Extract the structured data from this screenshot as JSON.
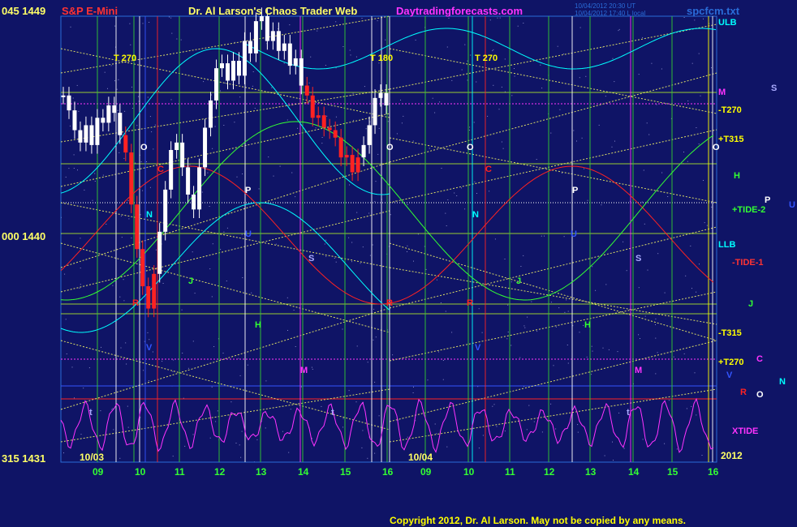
{
  "header": {
    "top_left_price": "045 1449",
    "instrument": "S&P E-Mini",
    "title": "Dr. Al Larson's Chaos Trader Web",
    "website": "Daytradingforecasts.com",
    "timestamp_1": "10/04/2012 20:30 UT",
    "timestamp_2": "10/04/2012 17:40 L local",
    "file": "spcfcm.txt"
  },
  "left_axis": {
    "mid_label": "000 1440",
    "bottom_label": "315 1431"
  },
  "footer": {
    "copyright": "Copyright 2012, Dr. Al Larson. May not be copied by any means."
  },
  "chart_data": {
    "type": "line",
    "title": "S&P E-Mini",
    "ylim": [
      1431,
      1449
    ],
    "y_ticks": [
      {
        "label": "1449",
        "code": "045"
      },
      {
        "label": "1440",
        "code": "000"
      },
      {
        "label": "1431",
        "code": "315"
      }
    ],
    "x_ticks_day1": [
      "09",
      "10",
      "11",
      "12",
      "13",
      "14",
      "15",
      "16"
    ],
    "x_ticks_day2": [
      "09",
      "10",
      "11",
      "12",
      "13",
      "14",
      "15",
      "16"
    ],
    "date_labels": [
      "10/03",
      "10/04",
      "2012"
    ],
    "right_labels": [
      {
        "text": "ULB",
        "color": "#00ffff"
      },
      {
        "text": "M",
        "color": "#ff33ff"
      },
      {
        "text": "-T270",
        "color": "#ffff00"
      },
      {
        "text": "+T315",
        "color": "#ffff00"
      },
      {
        "text": "O",
        "color": "#ffffff"
      },
      {
        "text": "H",
        "color": "#33ff33"
      },
      {
        "text": "+TIDE-2",
        "color": "#33ff33"
      },
      {
        "text": "LLB",
        "color": "#00ffff"
      },
      {
        "text": "-TIDE-1",
        "color": "#ff3333"
      },
      {
        "text": "J",
        "color": "#33ff33"
      },
      {
        "text": "-T315",
        "color": "#ffff00"
      },
      {
        "text": "+T270",
        "color": "#ffff00"
      },
      {
        "text": "C",
        "color": "#ff33ff"
      },
      {
        "text": "V",
        "color": "#3355ff"
      },
      {
        "text": "N",
        "color": "#00ffff"
      },
      {
        "text": "R",
        "color": "#ff2222"
      },
      {
        "text": "O",
        "color": "#ffffff"
      },
      {
        "text": "XTIDE",
        "color": "#ff33ff"
      },
      {
        "text": "S",
        "color": "#aaaaff"
      },
      {
        "text": "P",
        "color": "#ffffff"
      },
      {
        "text": "U",
        "color": "#3355ff"
      }
    ],
    "annotations": [
      {
        "text": "T 270",
        "color": "#ffff00"
      },
      {
        "text": "T 180",
        "color": "#ffff00"
      },
      {
        "text": "T 270",
        "color": "#ffff00"
      }
    ],
    "price_series": {
      "name": "S&P E-Mini",
      "values": [
        1445.8,
        1445.2,
        1444.4,
        1443.9,
        1444.6,
        1443.8,
        1444.9,
        1444.7,
        1445.4,
        1445.1,
        1444.2,
        1443.5,
        1441.4,
        1439.6,
        1438.1,
        1437.2,
        1438.6,
        1440.3,
        1442.0,
        1443.6,
        1443.9,
        1442.9,
        1441.8,
        1441.2,
        1442.9,
        1444.5,
        1445.6,
        1446.9,
        1447.1,
        1446.4,
        1447.2,
        1446.6,
        1448.0,
        1447.5,
        1448.8,
        1449.0,
        1448.0,
        1448.4,
        1447.6,
        1447.9,
        1447.0,
        1447.3,
        1446.2,
        1445.8,
        1444.9,
        1445.0,
        1444.5,
        1444.4,
        1444.1,
        1443.3,
        1443.4,
        1442.7,
        1443.3,
        1443.8,
        1444.6,
        1445.7,
        1445.9,
        1445.4
      ],
      "highlight_color": "#ff2222"
    }
  }
}
